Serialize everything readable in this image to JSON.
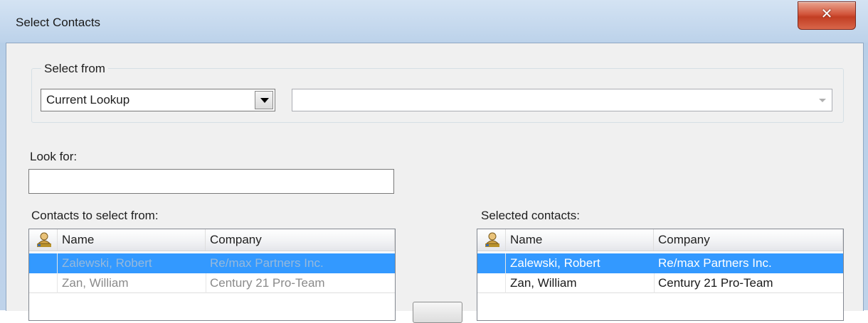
{
  "window": {
    "title": "Select Contacts",
    "close_glyph": "✕"
  },
  "select_from": {
    "label": "Select from",
    "source_value": "Current Lookup",
    "secondary_value": ""
  },
  "look_for": {
    "label": "Look for:",
    "value": ""
  },
  "left_list": {
    "label": "Contacts to select from:",
    "columns": [
      "Name",
      "Company"
    ],
    "rows": [
      {
        "name": "Zalewski, Robert",
        "company": "Re/max Partners Inc.",
        "selected": true
      },
      {
        "name": "Zan, William",
        "company": "Century 21 Pro-Team",
        "selected": false
      }
    ]
  },
  "right_list": {
    "label": "Selected contacts:",
    "columns": [
      "Name",
      "Company"
    ],
    "rows": [
      {
        "name": "Zalewski, Robert",
        "company": "Re/max Partners Inc.",
        "selected": true
      },
      {
        "name": "Zan, William",
        "company": "Century 21 Pro-Team",
        "selected": false
      }
    ]
  },
  "colors": {
    "selection": "#3399ff",
    "close_button": "#c23e23"
  },
  "icons": {
    "column_header": "contact-person-icon",
    "dropdown": "chevron-down-icon"
  }
}
